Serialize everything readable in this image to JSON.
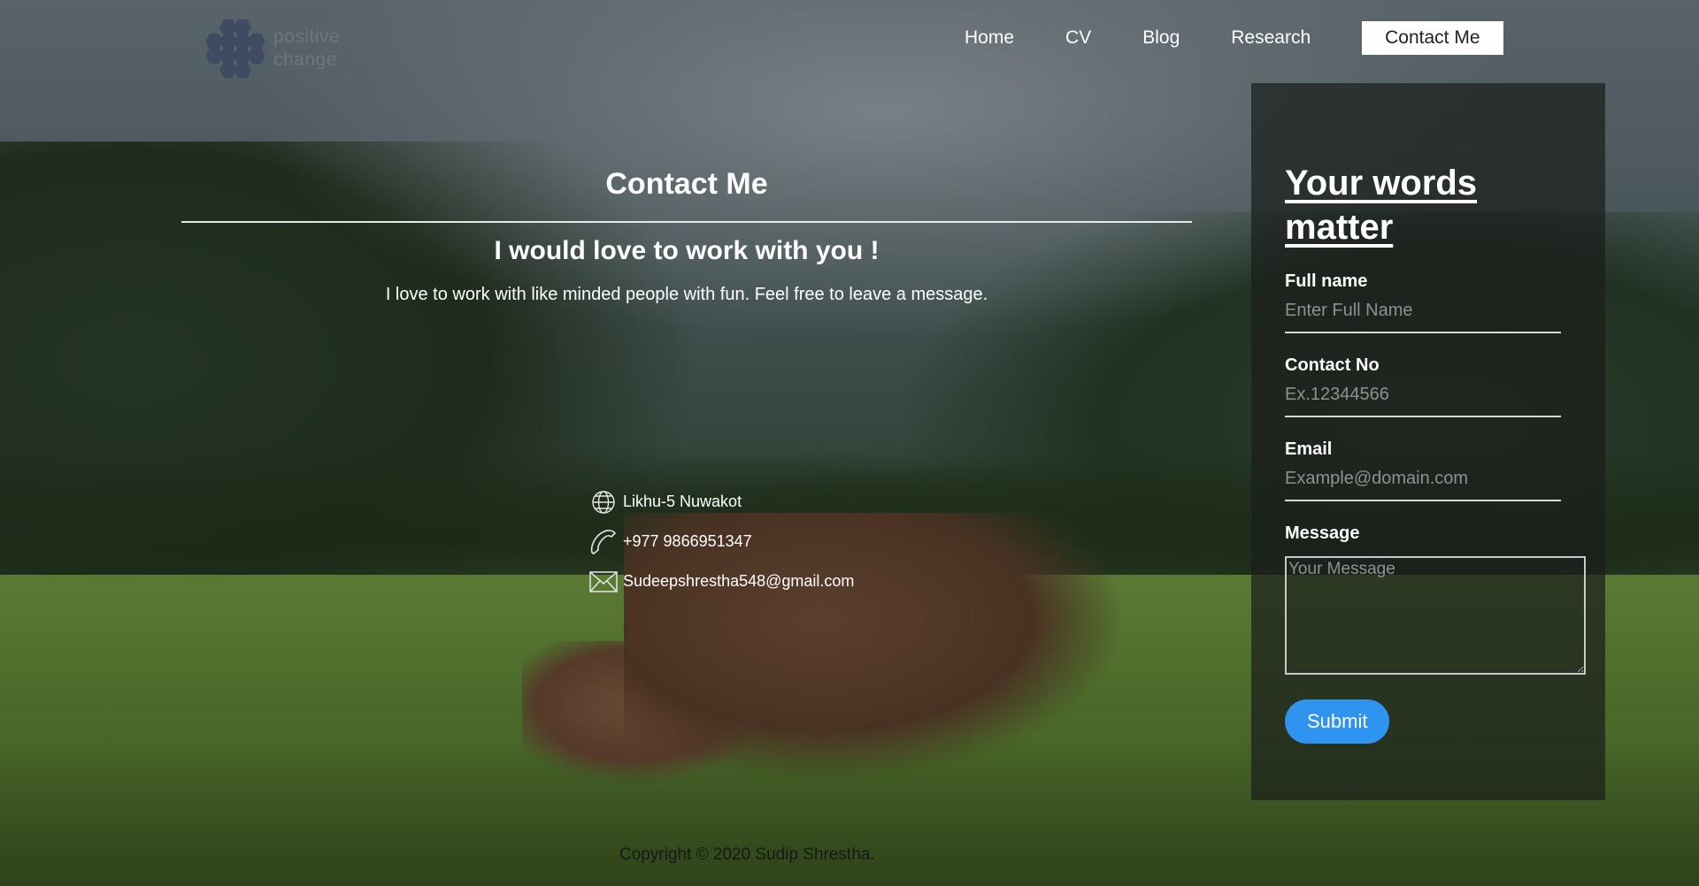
{
  "logo": {
    "line1": "positive",
    "line2": "change",
    "icon": "hexagon-cluster-logo"
  },
  "nav": {
    "items": [
      {
        "label": "Home"
      },
      {
        "label": "CV"
      },
      {
        "label": "Blog"
      },
      {
        "label": "Research"
      },
      {
        "label": "Contact Me",
        "active": true
      }
    ]
  },
  "main": {
    "title": "Contact Me",
    "subtitle": "I would love to work with you !",
    "description": "I love to work with like minded people with fun. Feel free to leave a message."
  },
  "contact": {
    "address": {
      "icon": "globe-icon",
      "text": "Likhu-5 Nuwakot"
    },
    "phone": {
      "icon": "phone-icon",
      "text": "+977 9866951347"
    },
    "email": {
      "icon": "envelope-icon",
      "text": "Sudeepshrestha548@gmail.com"
    }
  },
  "form": {
    "heading": "Your words matter",
    "full_name": {
      "label": "Full name",
      "placeholder": "Enter Full Name"
    },
    "contact_no": {
      "label": "Contact No",
      "placeholder": "Ex.12344566"
    },
    "email": {
      "label": "Email",
      "placeholder": "Example@domain.com"
    },
    "message": {
      "label": "Message",
      "placeholder": "Your Message"
    },
    "submit_label": "Submit"
  },
  "footer": {
    "copyright": "Copyright © 2020 Sudip Shrestha."
  },
  "colors": {
    "accent": "#2f93f0",
    "card_bg": "#1a1e1c",
    "logo_hex": "#3f4a63"
  }
}
